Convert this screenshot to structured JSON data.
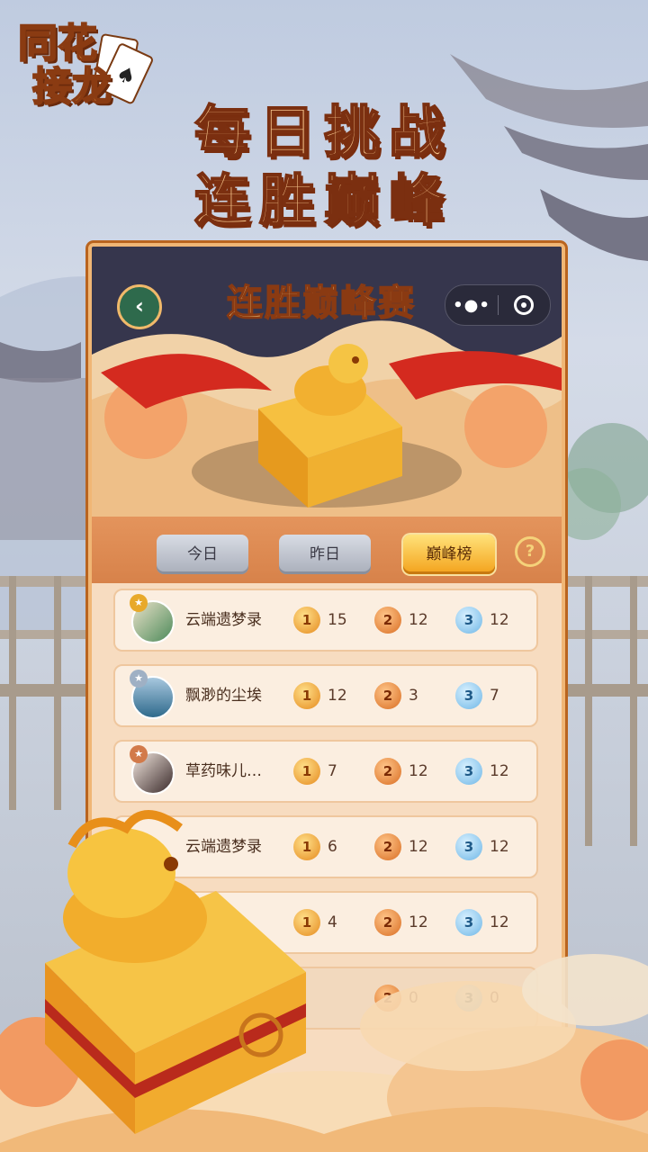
{
  "logo": {
    "line1": "同花",
    "line2": "接龙"
  },
  "promo": {
    "line1": "每日挑战",
    "line2": "连胜巅峰"
  },
  "app": {
    "title": "连胜巅峰赛",
    "capsule_dots": "•●•"
  },
  "tabs": [
    {
      "label": "今日",
      "active": false
    },
    {
      "label": "昨日",
      "active": false
    },
    {
      "label": "巅峰榜",
      "active": true
    }
  ],
  "help_label": "?",
  "leaderboard": [
    {
      "name": "云端遗梦录",
      "gold": "15",
      "orange": "12",
      "blue": "12"
    },
    {
      "name": "飘渺的尘埃",
      "gold": "12",
      "orange": "3",
      "blue": "7"
    },
    {
      "name": "草药味儿…",
      "gold": "7",
      "orange": "12",
      "blue": "12"
    },
    {
      "name": "云端遗梦录",
      "gold": "6",
      "orange": "12",
      "blue": "12"
    },
    {
      "name": "",
      "gold": "4",
      "orange": "12",
      "blue": "12"
    },
    {
      "name": "",
      "gold": "",
      "orange": "0",
      "blue": "0"
    }
  ],
  "medal_labels": {
    "gold": "1",
    "orange": "2",
    "blue": "3"
  },
  "colors": {
    "accent": "#f3a21b",
    "frame": "#f0b675",
    "header_bg": "#36364d"
  }
}
